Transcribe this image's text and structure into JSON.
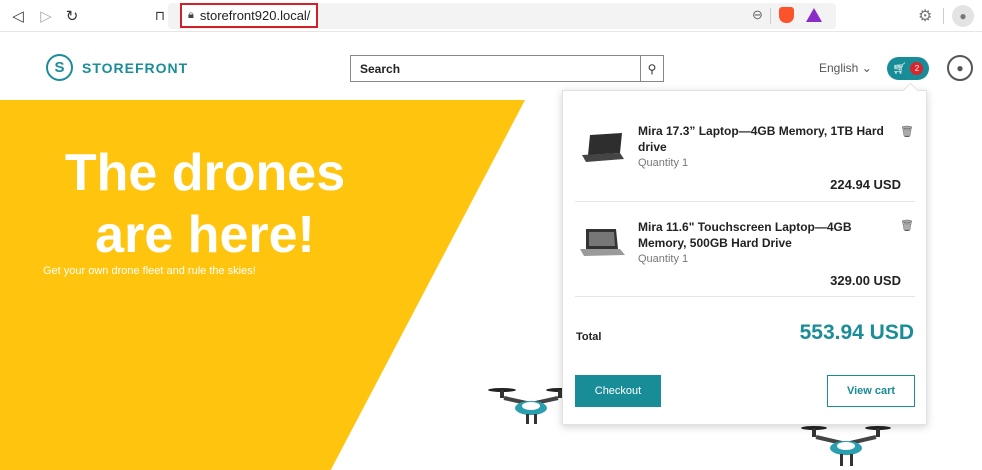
{
  "browser": {
    "url": "storefront920.local/"
  },
  "header": {
    "logo_text": "STOREFRONT",
    "search_value": "Search",
    "language": "English",
    "cart_count": "2"
  },
  "hero": {
    "title_line1": "The drones",
    "title_line2": "are here!",
    "subtitle": "Get your own drone fleet and rule the skies!"
  },
  "cart": {
    "items": [
      {
        "name": "Mira 17.3” Laptop—4GB Memory, 1TB Hard drive",
        "quantity": "Quantity 1",
        "price": "224.94 USD"
      },
      {
        "name": "Mira 11.6\" Touchscreen Laptop—4GB Memory, 500GB Hard Drive",
        "quantity": "Quantity 1",
        "price": "329.00 USD"
      }
    ],
    "total_label": "Total",
    "total_value": "553.94 USD",
    "checkout_label": "Checkout",
    "view_cart_label": "View cart"
  },
  "colors": {
    "brand": "#188c97",
    "hero_yellow": "#fec40e",
    "badge_red": "#d9252c"
  }
}
